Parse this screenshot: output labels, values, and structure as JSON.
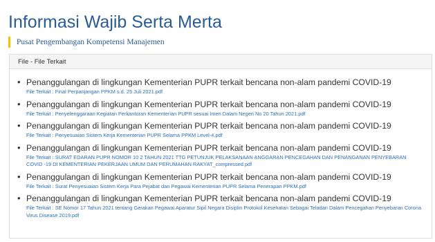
{
  "header": {
    "title": "Informasi Wajib Serta Merta",
    "subtitle": "Pusat Pengembangan Kompetensi Manajemen"
  },
  "panel": {
    "title": "File - File Terkait",
    "items": [
      {
        "title": "Penanggulangan di lingkungan Kementerian PUPR terkait bencana non-alam pandemi COVID-19",
        "file_label": "File Terkait :",
        "file_name": "Final Perpanjangan PPKM s.d. 25 Juli 2021.pdf"
      },
      {
        "title": "Penanggulangan di lingkungan Kementerian PUPR terkait bencana non-alam pandemi COVID-19",
        "file_label": "File Terkait :",
        "file_name": "Penyelenggaraan Kegiatan Perkantoran Kementerian PUPR sesuai Imen Dalam Negeri No 20 Tahun 2021.pdf"
      },
      {
        "title": "Penanggulangan di lingkungan Kementerian PUPR terkait bencana non-alam pandemi COVID-19",
        "file_label": "File Terkait :",
        "file_name": "Penyesuaian Sistem Kerja Kementerian PUPR Selama PPKM Level-4.pdf"
      },
      {
        "title": "Penanggulangan di lingkungan Kementerian PUPR terkait bencana non-alam pandemi COVID-19",
        "file_label": "File Terkait :",
        "file_name": "SURAT EDARAN PUPR NOMOR 10 2 TAHUN 2021 TTG PETUNJUK PELAKSANAAN ANGGARAN PENCEGAHAN DAN PENANGANAN PENYEBARAN COVID -19 DI KEMENTERIAN PEKERJAAN UMUM DAN PERUMAHAN RAKYAT_compressed.pdf"
      },
      {
        "title": "Penanggulangan di lingkungan Kementerian PUPR terkait bencana non-alam pandemi COVID-19",
        "file_label": "File Terkait :",
        "file_name": "Surat Penyesuaian Sistem Kerja Para Pejabat dan Pegawai Kementerian PUPR Selama Penerapan PPKM.pdf"
      },
      {
        "title": "Penanggulangan di lingkungan Kementerian PUPR terkait bencana non-alam pandemi COVID-19",
        "file_label": "File Terkait :",
        "file_name": "SE Nomor 17 Tahun 2021 tentang Gerakan Pegawai Aparatur Sipil Negara Disiplin Protokol Kesehatan Sebagai Teladan Dalam Pencegahan Penyebaran Corona Virus Disease 2019.pdf"
      }
    ]
  }
}
